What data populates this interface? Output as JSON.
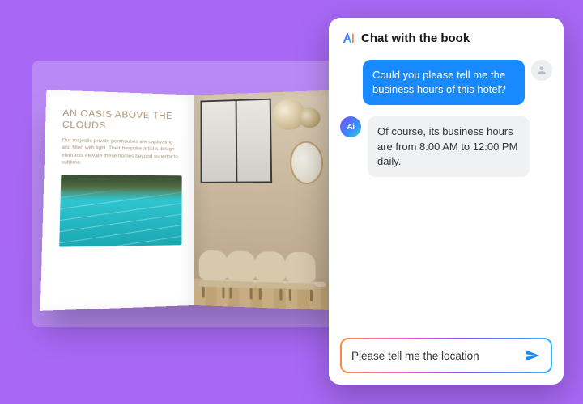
{
  "book": {
    "heading": "AN OASIS ABOVE THE CLOUDS",
    "body": "Our majestic private penthouses are captivating and filled with light. Their bespoke artistic design elements elevate these homes beyond superior to sublime."
  },
  "chat": {
    "title": "Chat with the book",
    "messages": {
      "user1": "Could you please tell me the business hours of this hotel?",
      "bot1": "Of course, its business hours are from 8:00 AM to 12:00 PM daily."
    },
    "input_value": "Please tell me the location",
    "bot_avatar_label": "Ai"
  }
}
